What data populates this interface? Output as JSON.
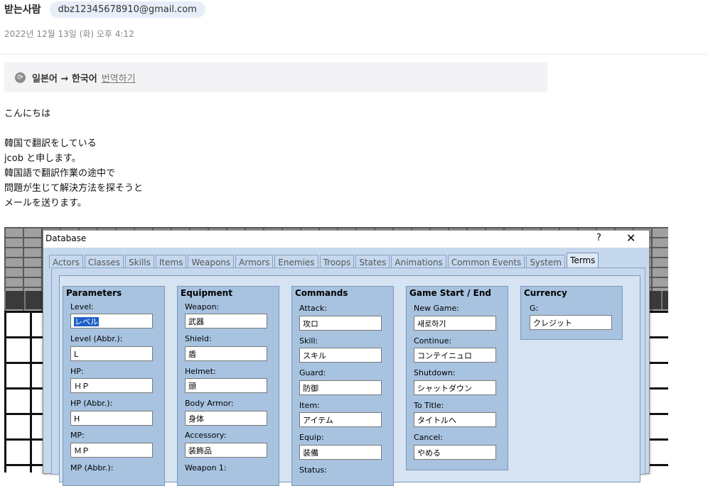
{
  "email": {
    "to_label": "받는사람",
    "to_address": "dbz12345678910@gmail.com",
    "date": "2022년 12월 13일 (화) 오후 4:12",
    "translate": {
      "icon": "translate-icon",
      "langs": "일본어 → 한국어",
      "action": "번역하기"
    },
    "body_lines": [
      "こんにちは",
      "",
      "韓国で翻訳をしている",
      "jcob と申します。",
      "韓国語で翻訳作業の途中で",
      "問題が生じて解決方法を探そうと",
      "メールを送ります。"
    ]
  },
  "database_window": {
    "title": "Database",
    "help": "?",
    "close": "✕",
    "tabs": [
      "Actors",
      "Classes",
      "Skills",
      "Items",
      "Weapons",
      "Armors",
      "Enemies",
      "Troops",
      "States",
      "Animations",
      "Common Events",
      "System",
      "Terms"
    ],
    "active_tab": "Terms",
    "groups": [
      {
        "title": "Parameters",
        "fields": [
          {
            "label": "Level:",
            "value": "レベル"
          },
          {
            "label": "Level (Abbr.):",
            "value": "L"
          },
          {
            "label": "HP:",
            "value": "ＨＰ"
          },
          {
            "label": "HP (Abbr.):",
            "value": "H"
          },
          {
            "label": "MP:",
            "value": "ＭＰ"
          },
          {
            "label": "MP (Abbr.):",
            "value": ""
          }
        ]
      },
      {
        "title": "Equipment",
        "fields": [
          {
            "label": "Weapon:",
            "value": "武器"
          },
          {
            "label": "Shield:",
            "value": "盾"
          },
          {
            "label": "Helmet:",
            "value": "頭"
          },
          {
            "label": "Body Armor:",
            "value": "身体"
          },
          {
            "label": "Accessory:",
            "value": "装飾品"
          },
          {
            "label": "Weapon 1:",
            "value": ""
          }
        ]
      },
      {
        "title": "Commands",
        "fields": [
          {
            "label": "Attack:",
            "value": "攻ロ"
          },
          {
            "label": "Skill:",
            "value": "スキル"
          },
          {
            "label": "Guard:",
            "value": "防御"
          },
          {
            "label": "Item:",
            "value": "アイテム"
          },
          {
            "label": "Equip:",
            "value": "装備"
          },
          {
            "label": "Status:",
            "value": ""
          }
        ]
      },
      {
        "title": "Game Start / End",
        "fields": [
          {
            "label": "New Game:",
            "value": "새로하기"
          },
          {
            "label": "Continue:",
            "value": "コンテイニュロ"
          },
          {
            "label": "Shutdown:",
            "value": "シャットダウン"
          },
          {
            "label": "To Title:",
            "value": "タイトルへ"
          },
          {
            "label": "Cancel:",
            "value": "やめる"
          }
        ]
      },
      {
        "title": "Currency",
        "fields": [
          {
            "label": "G:",
            "value": "クレジット"
          }
        ]
      }
    ]
  }
}
